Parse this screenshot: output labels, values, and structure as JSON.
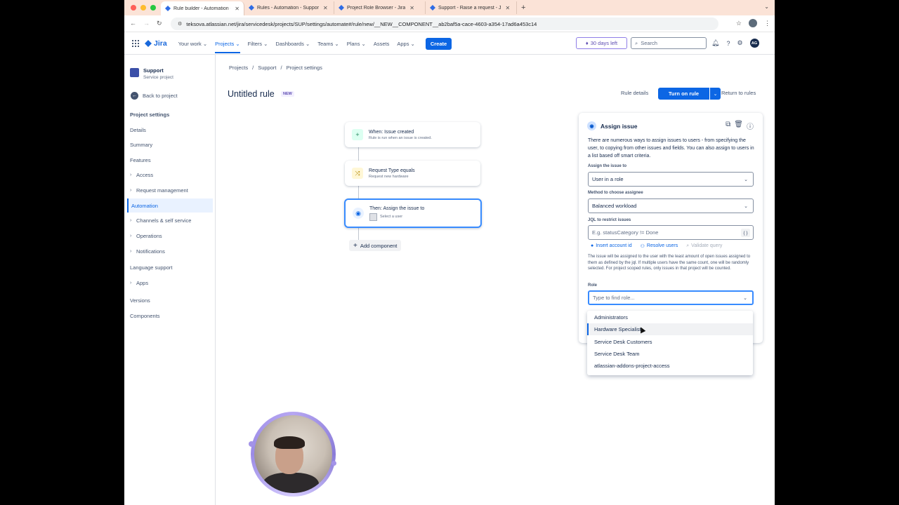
{
  "browser": {
    "tabs": [
      {
        "label": "Rule builder - Automation - S",
        "active": true
      },
      {
        "label": "Rules - Automation - Suppor",
        "active": false
      },
      {
        "label": "Project Role Browser - Jira",
        "active": false
      },
      {
        "label": "Support - Raise a request - J",
        "active": false
      }
    ],
    "url": "teksova.atlassian.net/jira/servicedesk/projects/SUP/settings/automate#/rule/new/__NEW__COMPONENT__ab2baf5a-cace-4603-a354-17ad6a453c14"
  },
  "topnav": {
    "product": "Jira",
    "menu": [
      "Your work",
      "Projects",
      "Filters",
      "Dashboards",
      "Teams",
      "Plans",
      "Assets",
      "Apps"
    ],
    "active_menu": "Projects",
    "create_label": "Create",
    "trial_label": "30 days left",
    "search_placeholder": "Search",
    "avatar_initials": "AG"
  },
  "sidebar": {
    "project_name": "Support",
    "project_type": "Service project",
    "back_label": "Back to project",
    "section_title": "Project settings",
    "items": [
      {
        "label": "Details",
        "expandable": false
      },
      {
        "label": "Summary",
        "expandable": false
      },
      {
        "label": "Features",
        "expandable": false
      },
      {
        "label": "Access",
        "expandable": true
      },
      {
        "label": "Request management",
        "expandable": true
      },
      {
        "label": "Automation",
        "expandable": false,
        "active": true
      },
      {
        "label": "Channels & self service",
        "expandable": true
      },
      {
        "label": "Operations",
        "expandable": true
      },
      {
        "label": "Notifications",
        "expandable": true
      },
      {
        "label": "Language support",
        "expandable": false
      },
      {
        "label": "Apps",
        "expandable": true
      },
      {
        "label": "Versions",
        "expandable": false
      },
      {
        "label": "Components",
        "expandable": false
      }
    ]
  },
  "breadcrumb": [
    "Projects",
    "Support",
    "Project settings"
  ],
  "rule": {
    "title": "Untitled rule",
    "badge": "NEW",
    "details_label": "Rule details",
    "turn_on_label": "Turn on rule",
    "return_label": "Return to rules"
  },
  "flow": {
    "trigger": {
      "title": "When: Issue created",
      "subtitle": "Rule is run when an issue is created."
    },
    "condition": {
      "title": "Request Type equals",
      "subtitle": "Request new hardware"
    },
    "action": {
      "title": "Then: Assign the issue to",
      "subtitle": "Select a user"
    },
    "add_label": "Add component"
  },
  "panel": {
    "title": "Assign issue",
    "description": "There are numerous ways to assign issues to users - from specifying the user, to copying from other issues and fields. You can also assign to users in a list based off smart criteria.",
    "assign_label": "Assign the issue to",
    "assign_value": "User in a role",
    "method_label": "Method to choose assignee",
    "method_value": "Balanced workload",
    "jql_label": "JQL to restrict issues",
    "jql_placeholder": "E.g. statusCategory != Done",
    "jql_button": "{ }",
    "insert_account": "Insert account id",
    "resolve_users": "Resolve users",
    "validate_query": "Validate query",
    "note": "The issue will be assigned to the user with the least amount of open issues assigned to them as defined by the jql. If multiple users have the same count, one will be randomly selected. For project scoped rules, only issues in that project will be counted.",
    "role_label": "Role",
    "role_placeholder": "Type to find role..."
  },
  "role_options": [
    "Administrators",
    "Hardware Specialist",
    "Service Desk Customers",
    "Service Desk Team",
    "atlassian-addons-project-access"
  ],
  "hovered_option": "Hardware Specialist"
}
